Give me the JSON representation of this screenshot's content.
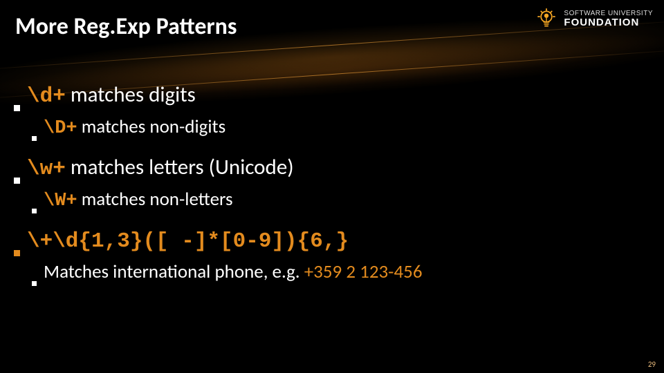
{
  "title": "More Reg.Exp Patterns",
  "logo": {
    "line1": "SOFTWARE UNIVERSITY",
    "line2": "FOUNDATION"
  },
  "bullets": [
    {
      "code": "\\d+",
      "text": " matches digits",
      "sub": {
        "code": "\\D+",
        "text": " matches non-digits"
      }
    },
    {
      "code": "\\w+",
      "text": " matches letters (Unicode)",
      "sub": {
        "code": "\\W+",
        "text": " matches non-letters"
      }
    },
    {
      "code": "\\+\\d{1,3}([ -]*[0-9]){6,}",
      "text": "",
      "sub": {
        "code": "",
        "prefix": "Matches international phone, e.g. ",
        "accent": "+359 2 123-456"
      }
    }
  ],
  "accent_color": "#e38b1e",
  "page_number": "29"
}
